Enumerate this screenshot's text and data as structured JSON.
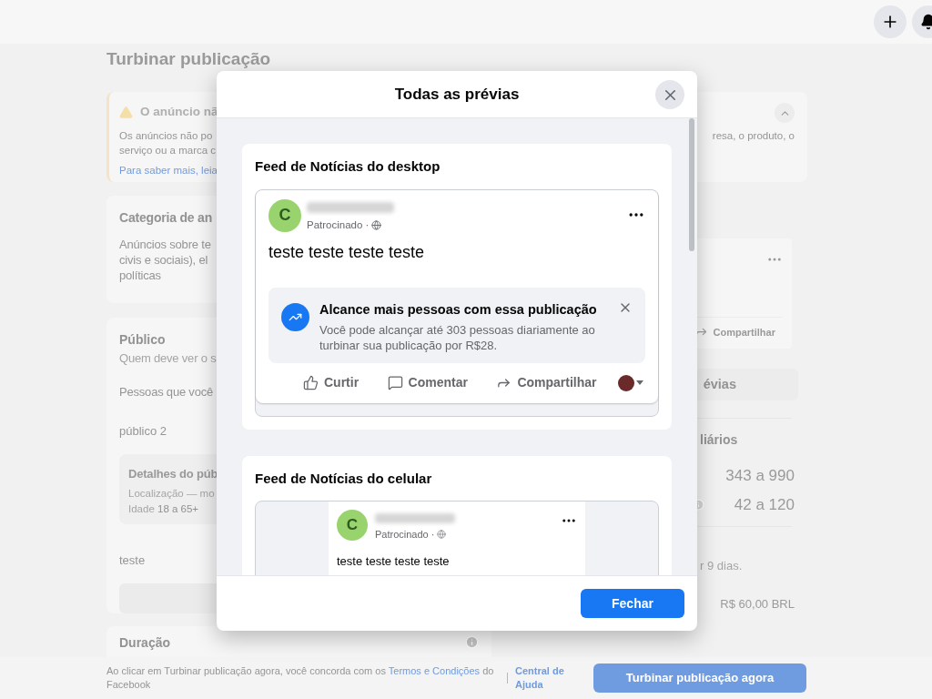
{
  "page": {
    "title": "Turbinar publicação",
    "notice": {
      "title": "O anúncio nã",
      "lines": [
        "Os anúncios não po",
        "serviço ou a marca c"
      ],
      "link": "Para saber mais, leia",
      "right_text": "resa, o produto, o"
    },
    "category": {
      "title": "Categoria de an",
      "lines": [
        "Anúncios sobre te",
        "civis e sociais), el",
        "políticas"
      ]
    },
    "audience": {
      "title": "Público",
      "subtitle": "Quem deve ver o s",
      "prompt": "Pessoas que você",
      "choice": "público 2",
      "details_title": "Detalhes do púb",
      "location": "Localização — mo",
      "age_label": "Idade",
      "age_value": "18 a 65+",
      "saved_name": "teste"
    },
    "duration": {
      "title": "Duração"
    },
    "right": {
      "preview_action": "Compartilhar",
      "all_previews_button": "évias",
      "daily_title": "liários",
      "stats": [
        "343 a 990",
        "42 a 120"
      ],
      "duration_note": "r 9 dias.",
      "total": "R$ 60,00 BRL"
    },
    "footer": {
      "before": "Ao clicar em Turbinar publicação agora, você concorda com os",
      "link": "Termos e Condições",
      "after": "do Facebook",
      "help_link": "Central de Ajuda",
      "submit": "Turbinar publicação agora"
    }
  },
  "modal": {
    "title": "Todas as prévias",
    "close_button": "Fechar",
    "sections": [
      {
        "kind": "desktop",
        "title": "Feed de Notícias do desktop",
        "avatar_letter": "C",
        "sponsored": "Patrocinado ·",
        "text": "teste teste teste teste",
        "promo": {
          "title": "Alcance mais pessoas com essa publicação",
          "body": "Você pode alcançar até 303 pessoas diariamente ao turbinar sua publicação por R$28."
        },
        "actions": [
          "Curtir",
          "Comentar",
          "Compartilhar"
        ]
      },
      {
        "kind": "mobile",
        "title": "Feed de Notícias do celular",
        "avatar_letter": "C",
        "sponsored": "Patrocinado ·",
        "text": "teste teste teste teste"
      }
    ]
  }
}
